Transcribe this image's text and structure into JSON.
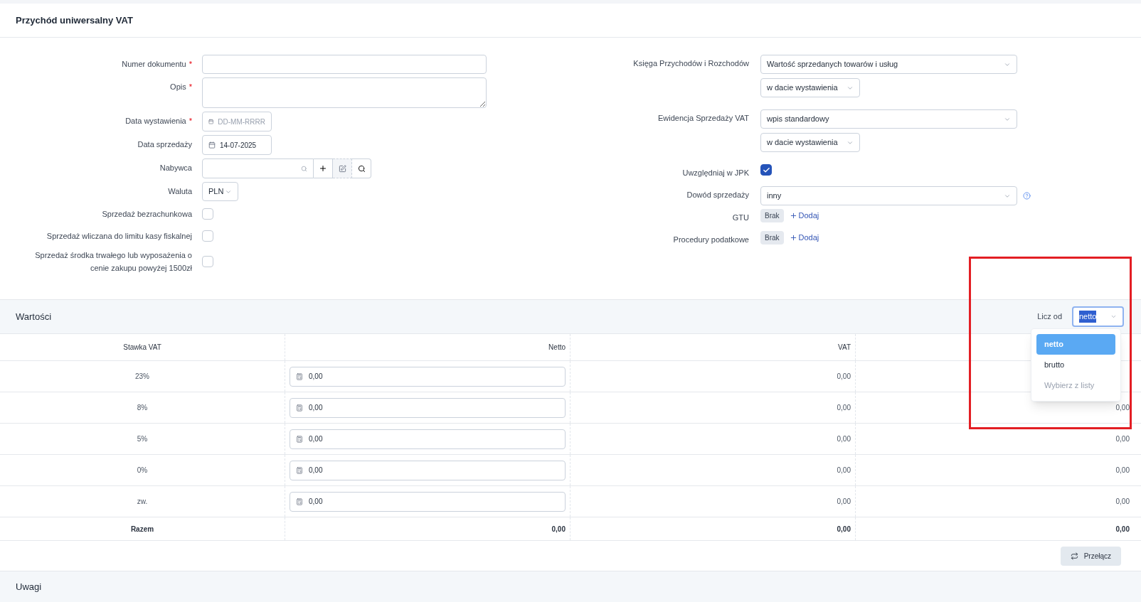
{
  "title": "Przychód uniwersalny VAT",
  "left_fields": [
    {
      "kind": "text",
      "label": "Numer dokumentu",
      "required_mark": "*"
    },
    {
      "kind": "textarea",
      "label": "Opis",
      "required_mark": "*"
    },
    {
      "kind": "date",
      "label": "Data wystawienia",
      "required_mark": "*",
      "placeholder": "DD-MM-RRRR"
    },
    {
      "kind": "date",
      "label": "Data sprzedaży",
      "value": "14-07-2025"
    },
    {
      "kind": "buyer",
      "label": "Nabywca"
    },
    {
      "kind": "select",
      "label": "Waluta",
      "value": "PLN"
    },
    {
      "kind": "checkbox",
      "label": "Sprzedaż bezrachunkowa",
      "checked": false
    },
    {
      "kind": "checkbox",
      "label": "Sprzedaż wliczana do limitu kasy fiskalnej",
      "checked": false
    },
    {
      "kind": "checkbox",
      "label": "Sprzedaż środka trwałego lub wyposażenia o cenie zakupu powyżej 1500zł",
      "checked": false
    }
  ],
  "right_fields": [
    {
      "kind": "selects",
      "label": "Księga Przychodów i Rozchodów",
      "selects": [
        "Wartość sprzedanych towarów i usług",
        "w dacie wystawienia"
      ]
    },
    {
      "kind": "selects",
      "label": "Ewidencja Sprzedaży VAT",
      "selects": [
        "wpis standardowy",
        "w dacie wystawienia"
      ]
    },
    {
      "kind": "checkbox",
      "label": "Uwzględniaj w JPK",
      "checked": true
    },
    {
      "kind": "select",
      "label": "Dowód sprzedaży",
      "value": "inny"
    },
    {
      "kind": "tags",
      "label": "GTU",
      "tag": "Brak",
      "action": "Dodaj"
    },
    {
      "kind": "tags",
      "label": "Procedury podatkowe",
      "tag": "Brak",
      "action": "Dodaj"
    }
  ],
  "values": {
    "title": "Wartości",
    "calc_label": "Licz od",
    "calc_value": "netto",
    "columns": [
      "Stawka VAT",
      "Netto",
      "VAT"
    ],
    "rows": [
      {
        "rate": "23%",
        "netto": "0,00",
        "vat": "0,00"
      },
      {
        "rate": "8%",
        "netto": "0,00",
        "vat": "0,00",
        "brutto": "0,00"
      },
      {
        "rate": "5%",
        "netto": "0,00",
        "vat": "0,00",
        "brutto": "0,00"
      },
      {
        "rate": "0%",
        "netto": "0,00",
        "vat": "0,00",
        "brutto": "0,00"
      },
      {
        "rate": "zw.",
        "netto": "0,00",
        "vat": "0,00",
        "brutto": "0,00"
      }
    ],
    "total": {
      "label": "Razem",
      "netto": "0,00",
      "vat": "0,00",
      "brutto": "0,00"
    },
    "switch_button": "Przełącz"
  },
  "dropdown": {
    "options": [
      {
        "label": "netto",
        "selected": true,
        "disabled": false
      },
      {
        "label": "brutto",
        "selected": false,
        "disabled": false
      },
      {
        "label": "Wybierz z listy",
        "selected": false,
        "disabled": true
      }
    ]
  },
  "notes": {
    "title": "Uwagi"
  }
}
